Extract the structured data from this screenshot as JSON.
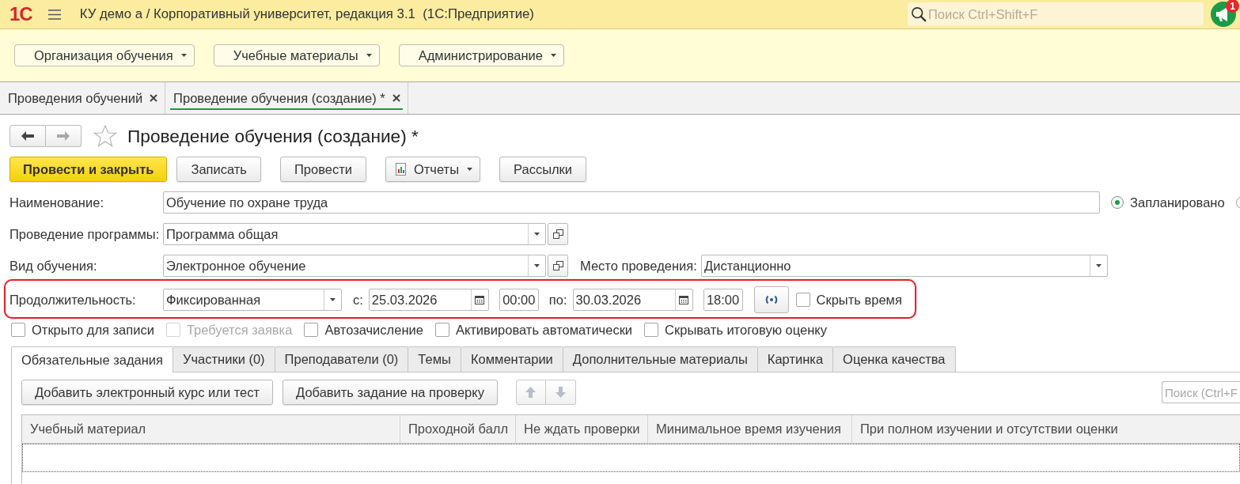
{
  "app_bar": {
    "logo": "1С",
    "title": "КУ демо а / Корпоративный университет, редакция 3.1  (1С:Предприятие)",
    "search": {
      "placeholder": "Поиск Ctrl+Shift+F"
    },
    "notifications": {
      "badge": "1"
    }
  },
  "sections": [
    "Организация обучения",
    "Учебные материалы",
    "Администрирование"
  ],
  "open_tabs": [
    {
      "label": "Проведения обучений",
      "selected": false
    },
    {
      "label": "Проведение обучения (создание) *",
      "selected": true
    }
  ],
  "form": {
    "navigation": {
      "back_disabled": false,
      "forward_disabled": true
    },
    "favorite": false,
    "title": "Проведение обучения (создание) *",
    "commands": [
      {
        "label": "Провести и закрыть",
        "kind": "primary"
      },
      {
        "label": "Записать",
        "kind": "plain"
      },
      {
        "label": "Провести",
        "kind": "plain"
      },
      {
        "label": "Отчеты",
        "kind": "menu"
      },
      {
        "label": "Рассылки",
        "kind": "plain"
      }
    ]
  },
  "fields": {
    "name": {
      "label": "Наименование:",
      "value": "Обучение по охране труда"
    },
    "status_options": [
      {
        "label": "Запланировано",
        "selected": true
      },
      {
        "selected": false
      }
    ],
    "program": {
      "label": "Проведение программы:",
      "value": "Программа общая"
    },
    "training_type": {
      "label": "Вид обучения:",
      "value": "Электронное обучение"
    },
    "venue": {
      "label": "Место проведения:",
      "value": "Дистанционно"
    },
    "duration": {
      "highlighted": true,
      "label": "Продолжительность:",
      "value": "Фиксированная",
      "from_label": "с:",
      "from_date": "25.03.2026",
      "from_time": "00:00",
      "to_label": "по:",
      "to_date": "30.03.2026",
      "to_time": "18:00",
      "hide_time": {
        "label": "Скрыть время",
        "checked": false
      }
    }
  },
  "flags": [
    {
      "label": "Открыто для записи",
      "checked": false,
      "disabled": false
    },
    {
      "label": "Требуется заявка",
      "checked": false,
      "disabled": true
    },
    {
      "label": "Автозачисление",
      "checked": false,
      "disabled": false
    },
    {
      "label": "Активировать автоматически",
      "checked": false,
      "disabled": false
    },
    {
      "label": "Скрывать итоговую оценку",
      "checked": false,
      "disabled": false
    }
  ],
  "detail_tabs": [
    {
      "label": "Обязательные задания",
      "selected": true
    },
    {
      "label": "Участники (0)",
      "selected": false
    },
    {
      "label": "Преподаватели (0)",
      "selected": false
    },
    {
      "label": "Темы",
      "selected": false
    },
    {
      "label": "Комментарии",
      "selected": false
    },
    {
      "label": "Дополнительные материалы",
      "selected": false
    },
    {
      "label": "Картинка",
      "selected": false
    },
    {
      "label": "Оценка качества",
      "selected": false
    }
  ],
  "toolbar": {
    "buttons": [
      "Добавить электронный курс или тест",
      "Добавить задание на проверку"
    ],
    "move_disabled": true,
    "search": {
      "placeholder": "Поиск (Ctrl+F"
    }
  },
  "table": {
    "columns": [
      "Учебный материал",
      "Проходной балл",
      "Не ждать проверки",
      "Минимальное время изучения",
      "При полном изучении и отсутствии оценки"
    ]
  }
}
